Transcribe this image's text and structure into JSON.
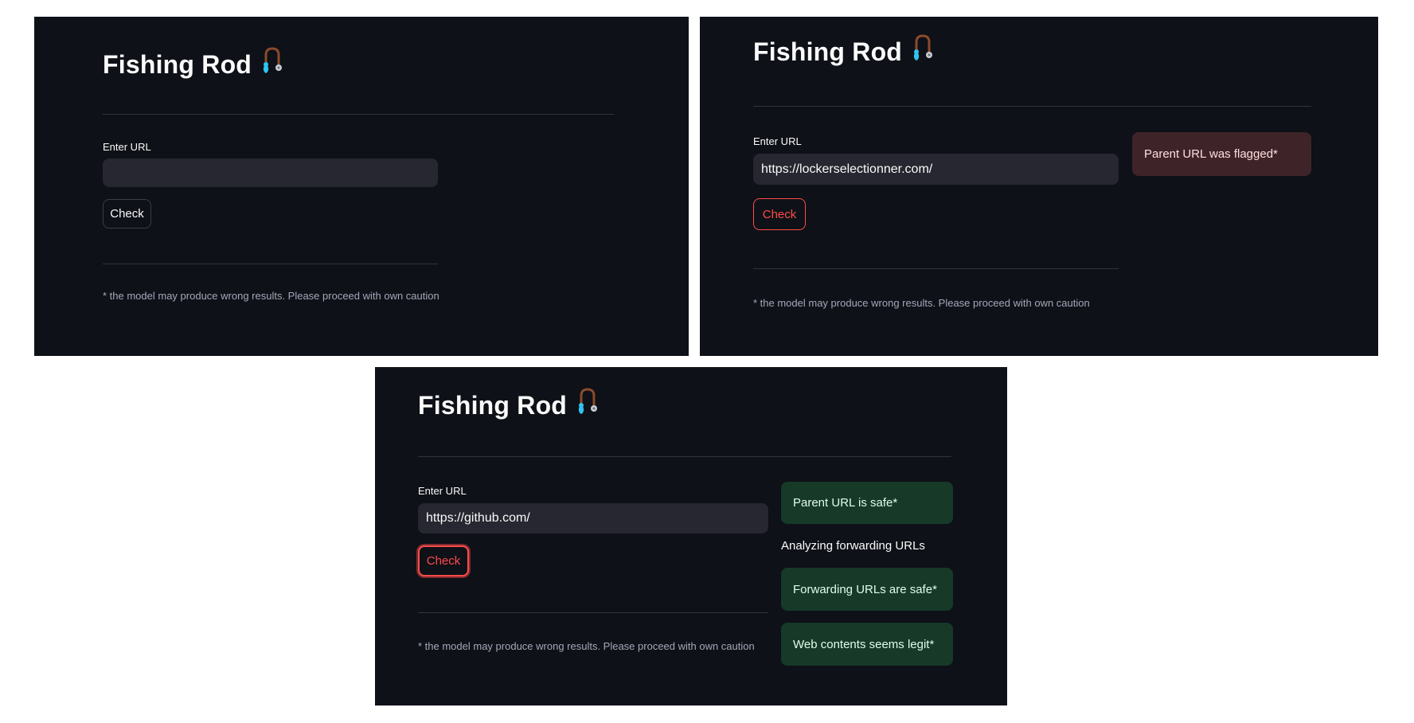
{
  "app": {
    "title": "Fishing Rod",
    "icon": "fishing-pole-icon"
  },
  "form": {
    "url_label": "Enter URL",
    "check_label": "Check",
    "disclaimer": "* the model may produce wrong results. Please proceed with own caution"
  },
  "panels": [
    {
      "url_value": ""
    },
    {
      "url_value": "https://lockerselectionner.com/",
      "result": "Parent URL was flagged*"
    },
    {
      "url_value": "https://github.com/",
      "parent_result": "Parent URL is safe*",
      "analyzing_text": "Analyzing forwarding URLs",
      "forwarding_result": "Forwarding URLs are safe*",
      "content_result": "Web contents seems legit*"
    }
  ],
  "colors": {
    "background": "#0e1117",
    "input_bg": "#262730",
    "accent": "#ff4b4b",
    "error_bg": "#3e2428",
    "success_bg": "#173928"
  }
}
